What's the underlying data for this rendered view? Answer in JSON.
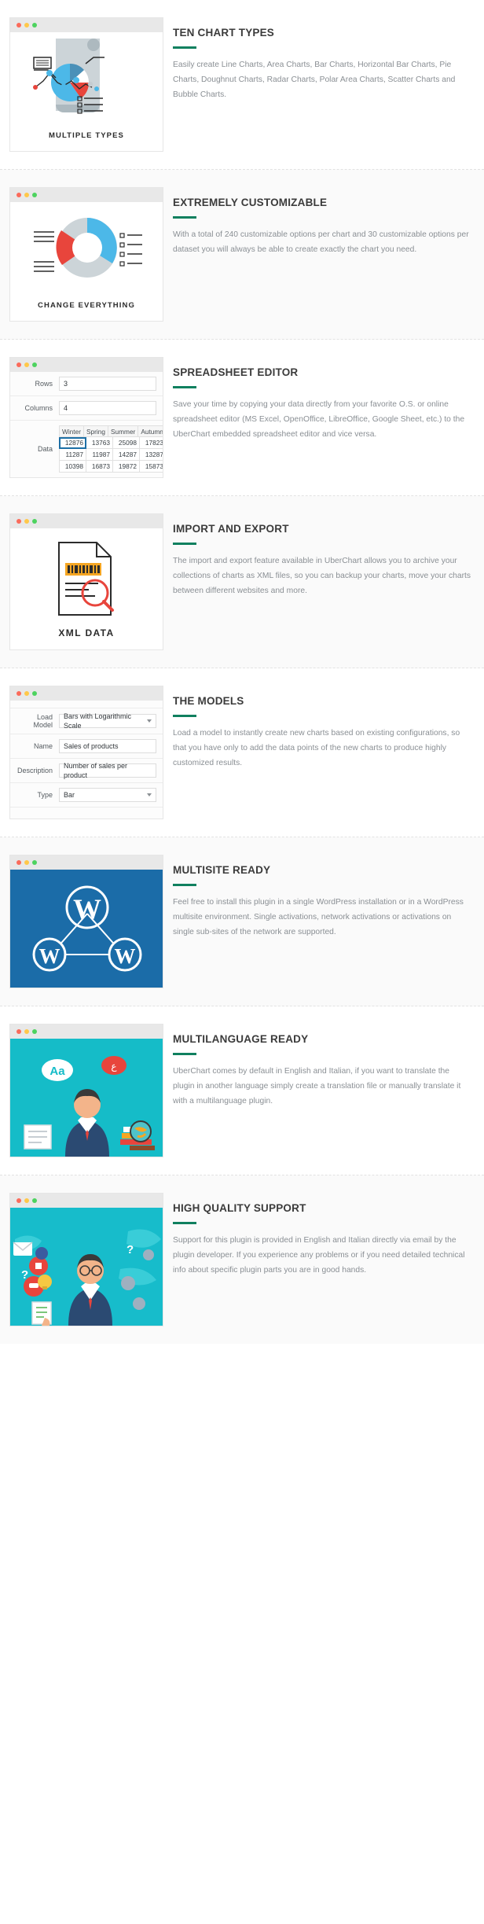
{
  "features": [
    {
      "id": "ten-chart-types",
      "title": "TEN CHART TYPES",
      "description": "Easily create Line Charts, Area Charts, Bar Charts, Horizontal Bar Charts, Pie Charts, Doughnut Charts, Radar Charts, Polar Area Charts, Scatter Charts and Bubble Charts.",
      "caption": "MULTIPLE TYPES",
      "accent": "#10805f"
    },
    {
      "id": "extremely-customizable",
      "title": "EXTREMELY CUSTOMIZABLE",
      "description": "With a total of 240 customizable options per chart and 30 customizable options per dataset you will always be able to create exactly the chart you need.",
      "caption": "CHANGE EVERYTHING",
      "accent": "#10805f"
    },
    {
      "id": "spreadsheet-editor",
      "title": "SPREADSHEET EDITOR",
      "description": "Save your time by copying your data directly from your favorite O.S. or online spreadsheet editor (MS Excel, OpenOffice, LibreOffice, Google Sheet, etc.) to the UberChart embedded spreadsheet editor and vice versa.",
      "accent": "#10805f"
    },
    {
      "id": "import-and-export",
      "title": "IMPORT AND EXPORT",
      "description": "The import and export feature available in UberChart allows you to archive your collections of charts as XML files, so you can backup your charts, move your charts between different websites and more.",
      "caption": "XML DATA",
      "accent": "#10805f"
    },
    {
      "id": "the-models",
      "title": "THE MODELS",
      "description": "Load a model to instantly create new charts based on existing configurations, so that you have only to add the data points of the new charts to produce highly customized results.",
      "accent": "#10805f"
    },
    {
      "id": "multisite-ready",
      "title": "MULTISITE READY",
      "description": "Feel free to install this plugin in a single WordPress installation or in a WordPress multisite environment. Single activations, network activations or activations on single sub-sites of the network are supported.",
      "accent": "#10805f"
    },
    {
      "id": "multilanguage-ready",
      "title": "MULTILANGUAGE READY",
      "description": "UberChart comes by default in English and Italian, if you want to translate the plugin in another language simply create a translation file or manually translate it with a multilanguage plugin.",
      "accent": "#10805f"
    },
    {
      "id": "high-quality-support",
      "title": "HIGH QUALITY SUPPORT",
      "description": "Support for this plugin is provided in English and Italian directly via email by the plugin developer. If you experience any problems or if you need detailed technical info about specific plugin parts you are in good hands.",
      "accent": "#10805f"
    }
  ],
  "spreadsheet": {
    "rows_label": "Rows",
    "rows_value": "3",
    "columns_label": "Columns",
    "columns_value": "4",
    "data_label": "Data",
    "headers": [
      "Winter",
      "Spring",
      "Summer",
      "Autumn"
    ],
    "rows": [
      [
        "12876",
        "13763",
        "25098",
        "17823"
      ],
      [
        "11287",
        "11987",
        "14287",
        "13287"
      ],
      [
        "10398",
        "16873",
        "19872",
        "15873"
      ]
    ],
    "selected_cell": "12876"
  },
  "models_form": {
    "load_model_label": "Load Model",
    "load_model_value": "Bars with Logarithmic Scale",
    "name_label": "Name",
    "name_value": "Sales of products",
    "description_label": "Description",
    "description_value": "Number of sales per product",
    "type_label": "Type",
    "type_value": "Bar"
  },
  "window_dots": {
    "red": "#fb6b5b",
    "yellow": "#ffc84a",
    "green": "#4dd35f"
  },
  "colors": {
    "accent_green": "#10805f",
    "chart_blue": "#4cb8e8",
    "chart_red": "#e8453c",
    "chart_dark_blue": "#4a90b8",
    "wp_blue": "#1b6ca8",
    "teal": "#15bcc8",
    "body_text": "#8a8f94",
    "title_text": "#3b3b3b"
  }
}
